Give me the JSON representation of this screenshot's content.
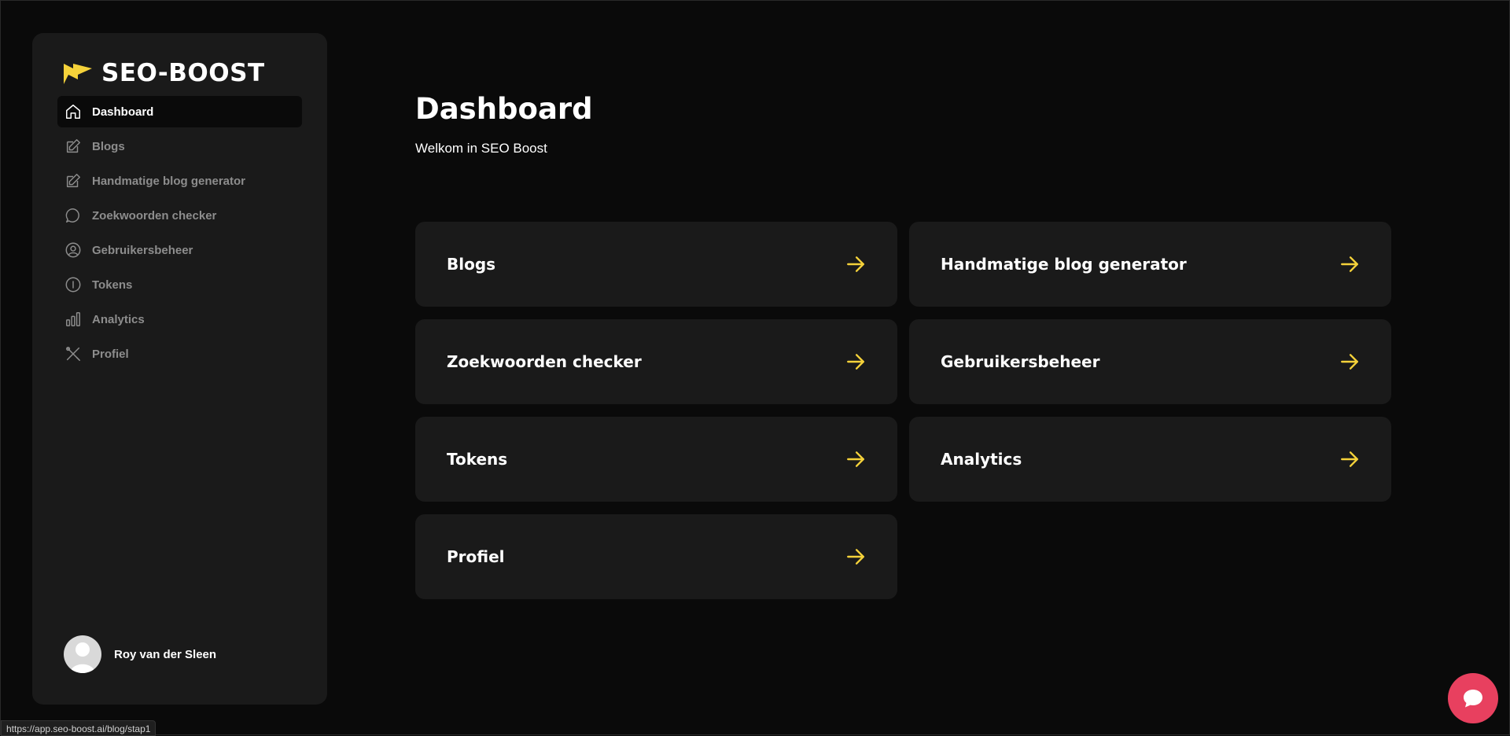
{
  "brand": {
    "name": "SEO-BOOST",
    "accent": "#f5d23a"
  },
  "sidebar": {
    "items": [
      {
        "label": "Dashboard",
        "icon": "home-icon",
        "active": true
      },
      {
        "label": "Blogs",
        "icon": "edit-icon",
        "active": false
      },
      {
        "label": "Handmatige blog generator",
        "icon": "edit-icon",
        "active": false
      },
      {
        "label": "Zoekwoorden checker",
        "icon": "chat-bubble-icon",
        "active": false
      },
      {
        "label": "Gebruikersbeheer",
        "icon": "user-circle-icon",
        "active": false
      },
      {
        "label": "Tokens",
        "icon": "token-icon",
        "active": false
      },
      {
        "label": "Analytics",
        "icon": "bar-chart-icon",
        "active": false
      },
      {
        "label": "Profiel",
        "icon": "tools-icon",
        "active": false
      }
    ],
    "user": {
      "name": "Roy van der Sleen"
    }
  },
  "main": {
    "title": "Dashboard",
    "subtitle": "Welkom in SEO Boost",
    "cards": [
      {
        "label": "Blogs"
      },
      {
        "label": "Handmatige blog generator"
      },
      {
        "label": "Zoekwoorden checker"
      },
      {
        "label": "Gebruikersbeheer"
      },
      {
        "label": "Tokens"
      },
      {
        "label": "Analytics"
      },
      {
        "label": "Profiel"
      }
    ]
  },
  "status_url": "https://app.seo-boost.ai/blog/stap1",
  "colors": {
    "chat_button": "#e8405f",
    "card_bg": "#1a1a1a",
    "page_bg": "#0a0a0a"
  }
}
